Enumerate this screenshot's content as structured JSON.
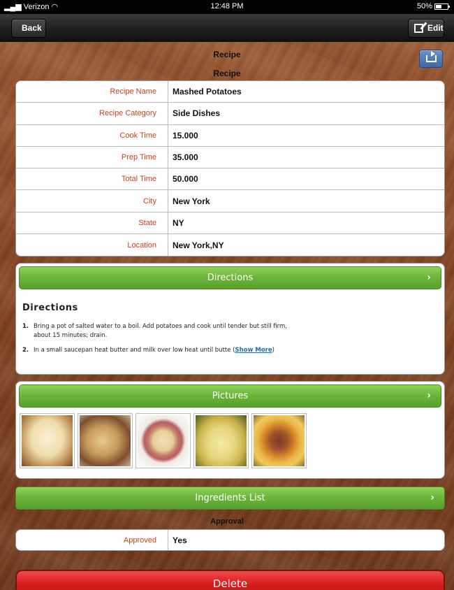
{
  "status_bar": {
    "carrier": "Verizon",
    "time": "12:48 PM",
    "battery": "50%"
  },
  "nav": {
    "back_label": "Back",
    "edit_label": "Edit"
  },
  "header": {
    "title": "Recipe",
    "subtitle": "Recipe"
  },
  "details": [
    {
      "label": "Recipe Name",
      "value": "Mashed Potatoes"
    },
    {
      "label": "Recipe Category",
      "value": "Side Dishes"
    },
    {
      "label": "Cook Time",
      "value": "15.000"
    },
    {
      "label": "Prep Time",
      "value": "35.000"
    },
    {
      "label": "Total Time",
      "value": "50.000"
    },
    {
      "label": "City",
      "value": "New York"
    },
    {
      "label": "State",
      "value": "NY"
    },
    {
      "label": "Location",
      "value": "New York,NY"
    }
  ],
  "directions": {
    "bar_label": "Directions",
    "heading": "Directions",
    "steps": [
      {
        "num": "1.",
        "text": "Bring a pot of salted water to a boil. Add potatoes and cook until tender but still firm, about 15 minutes; drain."
      },
      {
        "num": "2.",
        "text": "In a small saucepan heat butter and milk over low heat until butte (",
        "link": "Show More",
        "after": ")"
      }
    ]
  },
  "pictures": {
    "bar_label": "Pictures",
    "thumbnails": [
      "mashed-potatoes-bowl",
      "potato-bowl-fork",
      "mashed-potatoes-plate",
      "boiled-potatoes",
      "meat-with-potatoes"
    ]
  },
  "ingredients": {
    "bar_label": "Ingredients List"
  },
  "approval": {
    "title": "Approval",
    "label": "Approved",
    "value": "Yes"
  },
  "delete_label": "Delete",
  "colors": {
    "label_red": "#c8401a",
    "bar_green": "#6bb33a",
    "delete_red": "#d91e1e",
    "share_blue": "#4a72b0"
  }
}
